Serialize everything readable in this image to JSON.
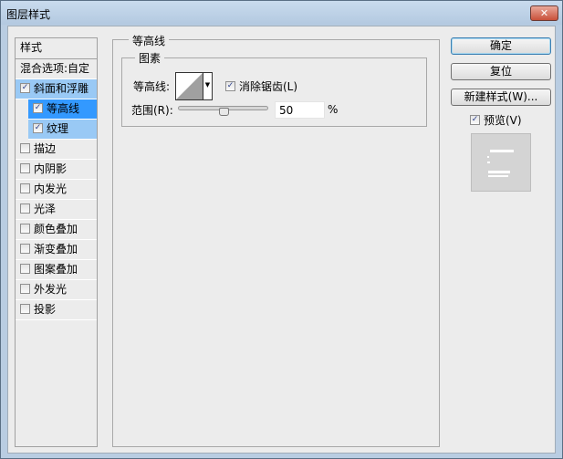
{
  "window": {
    "title": "图层样式",
    "close": "✕"
  },
  "sidebar": {
    "header": "样式",
    "blend": "混合选项:自定",
    "items": [
      {
        "label": "斜面和浮雕",
        "checked": true
      },
      {
        "label": "等高线",
        "checked": true
      },
      {
        "label": "纹理",
        "checked": true
      },
      {
        "label": "描边",
        "checked": false
      },
      {
        "label": "内阴影",
        "checked": false
      },
      {
        "label": "内发光",
        "checked": false
      },
      {
        "label": "光泽",
        "checked": false
      },
      {
        "label": "颜色叠加",
        "checked": false
      },
      {
        "label": "渐变叠加",
        "checked": false
      },
      {
        "label": "图案叠加",
        "checked": false
      },
      {
        "label": "外发光",
        "checked": false
      },
      {
        "label": "投影",
        "checked": false
      }
    ]
  },
  "panel": {
    "title": "等高线",
    "group": "图素",
    "contour_label": "等高线:",
    "antialias_label": "消除锯齿(L)",
    "antialias_checked": true,
    "range_label": "范围(R):",
    "range_value": "50",
    "range_unit": "%",
    "range_percent": 50
  },
  "buttons": {
    "ok": "确定",
    "reset": "复位",
    "new_style": "新建样式(W)...",
    "preview_label": "预览(V)",
    "preview_checked": true
  },
  "check_mark": "✓"
}
